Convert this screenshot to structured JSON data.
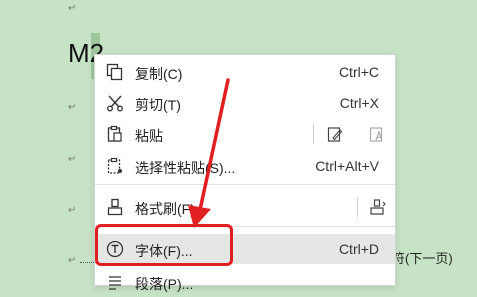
{
  "document": {
    "paragraph_mark": "↵",
    "heading_text": "M2",
    "trailing_text": "符(下一页)"
  },
  "context_menu": {
    "items": [
      {
        "label": "复制(C)",
        "shortcut": "Ctrl+C",
        "icon": "copy-icon"
      },
      {
        "label": "剪切(T)",
        "shortcut": "Ctrl+X",
        "icon": "scissors-icon"
      },
      {
        "label": "粘贴",
        "icon": "clipboard-icon"
      },
      {
        "label": "选择性粘贴(S)...",
        "shortcut": "Ctrl+Alt+V",
        "icon": "paste-special-icon"
      },
      {
        "label": "格式刷(F)",
        "icon": "format-brush-icon"
      },
      {
        "label": "字体(F)...",
        "shortcut": "Ctrl+D",
        "icon": "font-icon"
      },
      {
        "label": "段落(P)...",
        "icon": "paragraph-icon"
      }
    ]
  },
  "annotation": {
    "color": "#e02020"
  },
  "colors": {
    "background": "#c7e3c6",
    "highlight": "#e6e6e6"
  }
}
